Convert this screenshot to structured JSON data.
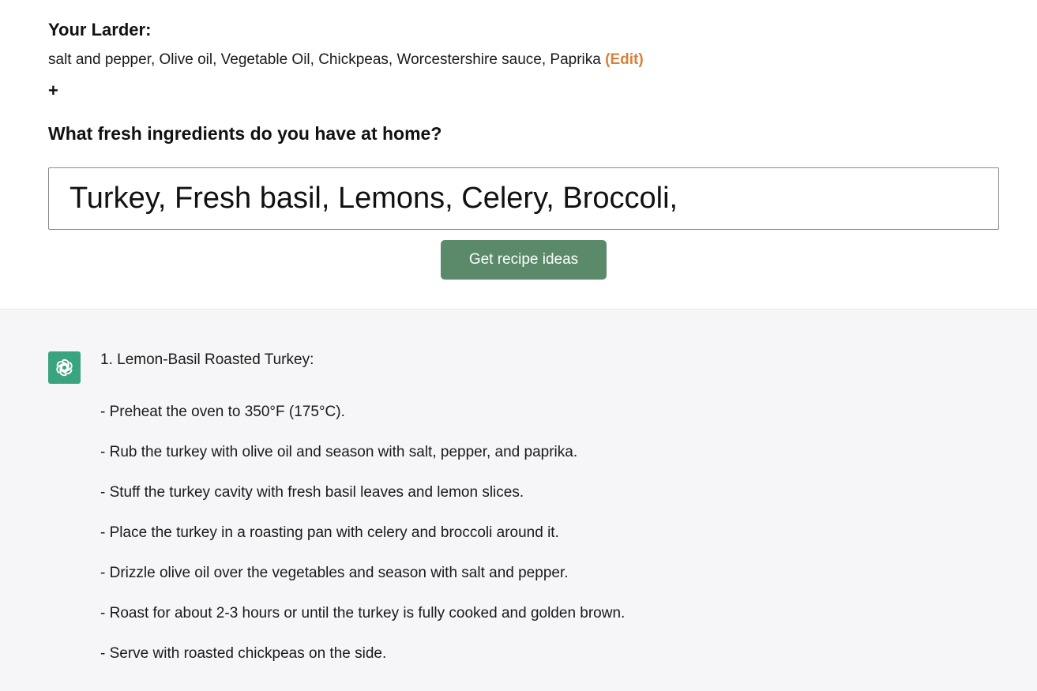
{
  "larder": {
    "title": "Your Larder:",
    "items_text": "salt and pepper, Olive oil, Vegetable Oil, Chickpeas, Worcestershire sauce, Paprika",
    "edit_label": "(Edit)",
    "add_label": "+"
  },
  "fresh": {
    "question": "What fresh ingredients do you have at home?",
    "input_value": "Turkey, Fresh basil, Lemons, Celery, Broccoli,",
    "button_label": "Get recipe ideas"
  },
  "response": {
    "avatar_icon": "openai-logo-icon",
    "heading": "1. Lemon-Basil Roasted Turkey:",
    "steps": [
      "- Preheat the oven to 350°F (175°C).",
      "- Rub the turkey with olive oil and season with salt, pepper, and paprika.",
      "- Stuff the turkey cavity with fresh basil leaves and lemon slices.",
      "- Place the turkey in a roasting pan with celery and broccoli around it.",
      "- Drizzle olive oil over the vegetables and season with salt and pepper.",
      "- Roast for about 2-3 hours or until the turkey is fully cooked and golden brown.",
      "- Serve with roasted chickpeas on the side."
    ]
  },
  "colors": {
    "accent_button": "#5a8a6a",
    "edit_link": "#d9813a",
    "avatar_bg": "#3aa37f",
    "response_bg": "#f6f6f8"
  }
}
